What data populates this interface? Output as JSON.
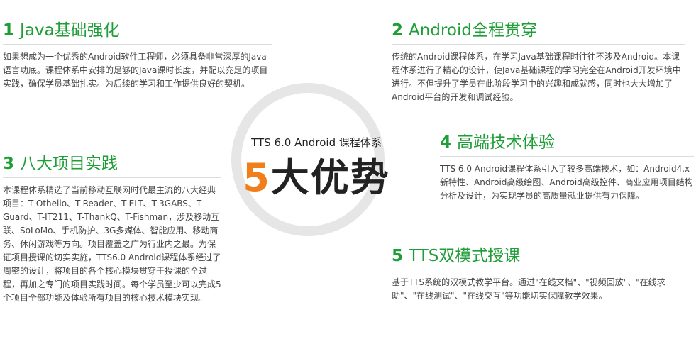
{
  "center": {
    "subtitle": "TTS 6.0 Android 课程体系",
    "headline_accent": "5",
    "headline_rest": "大优势",
    "accent_color": "#f07e1a"
  },
  "sections": [
    {
      "number": "1",
      "title": "Java基础强化",
      "text": "如果想成为一个优秀的Android软件工程师，必须具备非常深厚的Java语言功底。课程体系中安排的足够的Java课时长度，并配以充足的项目实践，确保学员基础扎实。为后续的学习和工作提供良好的契机。"
    },
    {
      "number": "2",
      "title": "Android全程贯穿",
      "text": "传统的Android课程体系，在学习Java基础课程时往往不涉及Android。本课程体系进行了精心的设计，使Java基础课程的学习完全在Android开发环境中进行。不但提升了学员在此阶段学习中的兴趣和成就感，同时也大大增加了Android平台的开发和调试经验。"
    },
    {
      "number": "3",
      "title": "八大项目实践",
      "text": "本课程体系精选了当前移动互联网时代最主流的八大经典项目：T-Othello、T-Reader、T-ELT、T-3GABS、T-Guard、T-IT211、T-ThankQ、T-Fishman，涉及移动互联、SoLoMo、手机防护、3G多媒体、智能应用、移动商务、休闲游戏等方向。项目覆盖之广为行业内之最。为保证项目授课的切实实施，TTS6.0 Android课程体系经过了周密的设计，将项目的各个核心模块贯穿于授课的全过程，再加之专门的项目实践时间。每个学员至少可以完成5个项目全部功能及体验所有项目的核心技术模块实现。"
    },
    {
      "number": "4",
      "title": "高端技术体验",
      "text": "TTS 6.0 Android课程体系引入了较多高端技术，如：Android4.x新特性、Android高级绘图、Android高级控件、商业应用项目结构分析及设计，为实现学员的高质量就业提供有力保障。"
    },
    {
      "number": "5",
      "title": "TTS双模式授课",
      "text": "基于TTS系统的双模式教学平台。通过\"在线文档\"、\"视频回放\"、\"在线求助\"、\"在线测试\"、\"在线交互\"等功能切实保障教学效果。"
    }
  ],
  "colors": {
    "heading": "#1f9e37",
    "body_text": "#444444",
    "ring": "#e6e6e6"
  }
}
